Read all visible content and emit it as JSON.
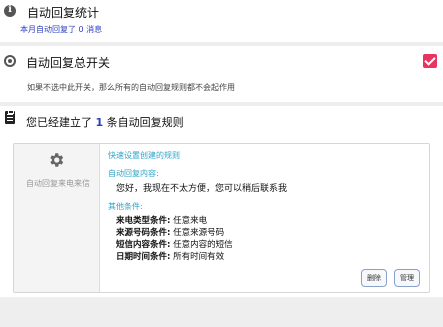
{
  "stats": {
    "title": "自动回复统计",
    "subtitle": "本月自动回复了 0 消息"
  },
  "master_switch": {
    "title": "自动回复总开关",
    "description": "如果不选中此开关，那么所有的自动回复规则都不会起作用",
    "checked": true,
    "checkbox_color": "#e8345f"
  },
  "rules": {
    "title_prefix": "您已经建立了",
    "count": "1",
    "title_suffix": "条自动回复规则"
  },
  "rule_card": {
    "type_label": "自动回复来电来信",
    "quick_title": "快速设置创建的规则",
    "content_label": "自动回复内容:",
    "content_text": "您好，我现在不太方便，您可以稍后联系我",
    "other_label": "其他条件:",
    "conditions": [
      {
        "key": "来电类型条件:",
        "value": "任意来电"
      },
      {
        "key": "来源号码条件:",
        "value": "任意来源号码"
      },
      {
        "key": "短信内容条件:",
        "value": "任意内容的短信"
      },
      {
        "key": "日期时间条件:",
        "value": "所有时间有效"
      }
    ],
    "delete_label": "删除",
    "manage_label": "管理"
  },
  "colors": {
    "link_blue": "#2a3fbf",
    "accent_teal": "#2ea4c8",
    "checkbox_pink": "#e8345f"
  },
  "icons": {
    "stats": "info-icon",
    "switch": "radio-icon",
    "rules": "clipboard-list-icon",
    "rule_type": "gear-icon"
  }
}
